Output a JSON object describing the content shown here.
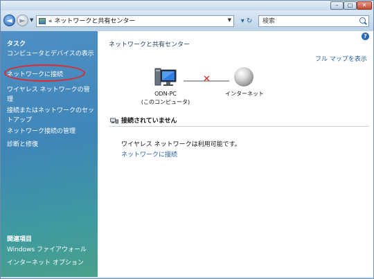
{
  "window": {
    "controls": {
      "minimize": "–",
      "maximize": "□",
      "close": "✕"
    }
  },
  "navbar": {
    "back_glyph": "◄",
    "forward_glyph": "►",
    "dropdown_glyph": "▼",
    "address_text": "« ネットワークと共有センター",
    "refresh_glyph": "▾ ↻",
    "search_placeholder": "検索"
  },
  "sidebar": {
    "tasks_title": "タスク",
    "tasks": [
      "コンピュータとデバイスの表示",
      "ネットワークに接続",
      "ワイヤレス ネットワークの管理",
      "接続またはネットワークのセットアップ",
      "ネットワーク接続の管理",
      "診断と修復"
    ],
    "related_title": "関連項目",
    "related": [
      "Windows ファイアウォール",
      "インターネット オプション"
    ]
  },
  "main": {
    "help_glyph": "?",
    "title": "ネットワークと共有センター",
    "full_map_link": "フル マップを表示",
    "pc_name": "ODN-PC",
    "pc_sub": "(このコンピュータ)",
    "disconnect_mark": "✕",
    "internet_label": "インターネット",
    "status": "接続されていません",
    "info": "ワイヤレス ネットワークは利用可能です。",
    "connect_link": "ネットワークに接続"
  },
  "colors": {
    "accent_link": "#2a5fa8",
    "highlight_ring": "#e5262a",
    "disconnect_x": "#e01818"
  },
  "icons": [
    "back-arrow-icon",
    "forward-arrow-icon",
    "network-folder-icon",
    "refresh-icon",
    "search-icon",
    "help-icon",
    "computer-icon",
    "internet-globe-icon",
    "network-status-icon"
  ]
}
